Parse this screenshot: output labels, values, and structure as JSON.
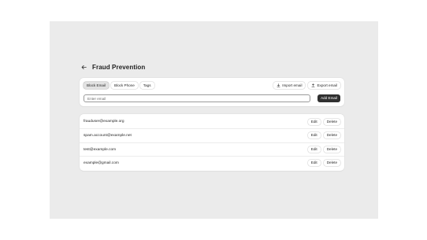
{
  "header": {
    "title": "Fraud Prevention",
    "back_icon": "arrow-left-icon"
  },
  "tabs": [
    {
      "label": "Block Email",
      "active": true
    },
    {
      "label": "Block Phone",
      "active": false
    },
    {
      "label": "Tags",
      "active": false
    }
  ],
  "toolbar": {
    "import_label": "Import email",
    "export_label": "Export email"
  },
  "input": {
    "placeholder": "Enter email",
    "value": ""
  },
  "add_button_label": "Add Email",
  "emails": [
    {
      "email": "frauduser@example.org",
      "edit": "Edit",
      "delete": "Delete"
    },
    {
      "email": "spam.account@example.net",
      "edit": "Edit",
      "delete": "Delete"
    },
    {
      "email": "test@example.com",
      "edit": "Edit",
      "delete": "Delete"
    },
    {
      "email": "example@gmail.com",
      "edit": "Edit",
      "delete": "Delete"
    }
  ],
  "colors": {
    "background": "#ebebeb",
    "card": "#ffffff",
    "primary_button": "#303030",
    "active_tab": "#e2e2e2"
  }
}
